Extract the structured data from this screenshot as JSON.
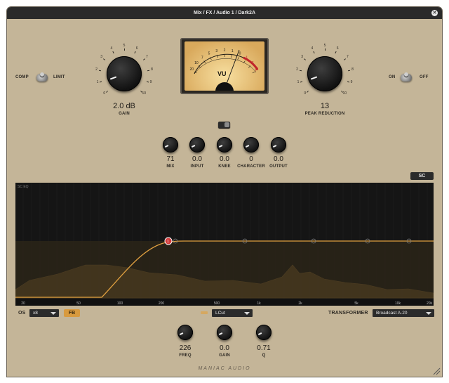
{
  "window": {
    "title": "Mix / FX / Audio 1 / Dark2A",
    "close_glyph": "✕"
  },
  "comp_limit": {
    "left_label": "COMP",
    "right_label": "LIMIT"
  },
  "on_off": {
    "left_label": "ON",
    "right_label": "OFF"
  },
  "gain": {
    "value": "2.0 dB",
    "label": "GAIN",
    "scale": [
      "0",
      "1",
      "2",
      "3",
      "4",
      "5",
      "6",
      "7",
      "8",
      "9",
      "10"
    ]
  },
  "peak_reduction": {
    "value": "13",
    "label": "PEAK REDUCTION",
    "scale": [
      "0",
      "1",
      "2",
      "3",
      "4",
      "5",
      "6",
      "7",
      "8",
      "9",
      "10"
    ]
  },
  "vu": {
    "label": "VU",
    "scale": [
      "20",
      "10",
      "7",
      "5",
      "3",
      "2",
      "1",
      "0",
      "1",
      "2",
      "3"
    ],
    "plus": "+"
  },
  "small_knobs": [
    {
      "value": "71",
      "label": "MIX"
    },
    {
      "value": "0.0",
      "label": "INPUT"
    },
    {
      "value": "0.0",
      "label": "KNEE"
    },
    {
      "value": "0",
      "label": "CHARACTER"
    },
    {
      "value": "0.0",
      "label": "OUTPUT"
    }
  ],
  "sc_button": "SC",
  "eq": {
    "label": "SC EQ",
    "freq_labels": [
      "20",
      "50",
      "100",
      "200",
      "500",
      "1k",
      "2k",
      "5k",
      "10k",
      "20k"
    ],
    "handle_number": "1",
    "accent": "#e0a040"
  },
  "os": {
    "label": "OS",
    "value": "x8"
  },
  "fb_button": "FB",
  "filter": {
    "value": "LCut"
  },
  "transformer": {
    "label": "TRANSFORMER",
    "value": "Broadcast A-20"
  },
  "bottom_knobs": [
    {
      "value": "226",
      "label": "FREQ"
    },
    {
      "value": "0.0",
      "label": "GAIN"
    },
    {
      "value": "0.71",
      "label": "Q"
    }
  ],
  "brand": "MANIAC AUDIO"
}
